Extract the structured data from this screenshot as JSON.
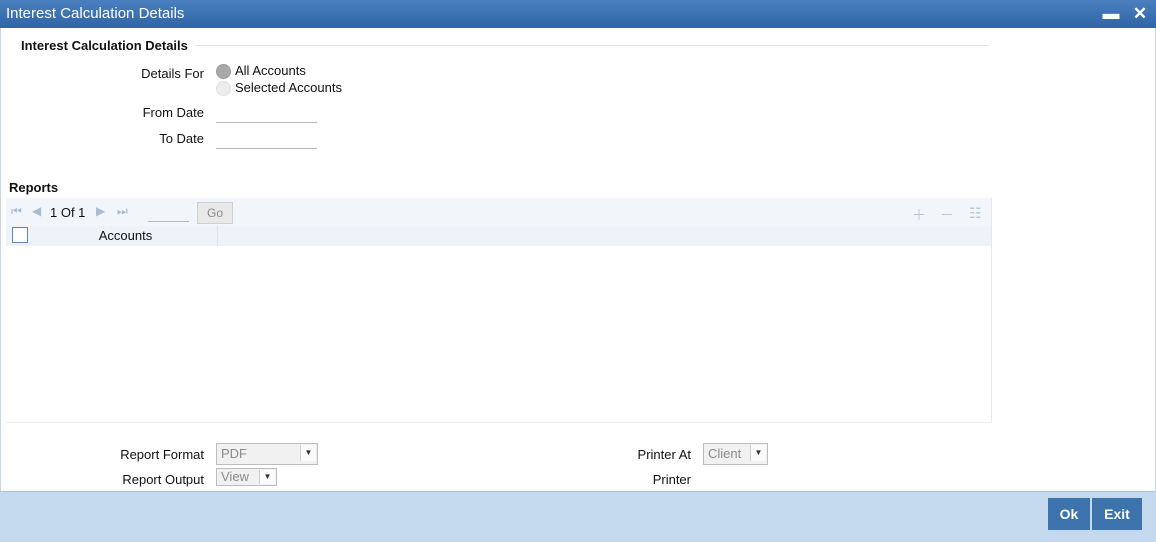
{
  "window": {
    "title": "Interest Calculation Details"
  },
  "form": {
    "section_title": "Interest Calculation Details",
    "details_for_label": "Details For",
    "options": [
      "All Accounts",
      "Selected Accounts"
    ],
    "selected_option": "All Accounts",
    "from_date_label": "From Date",
    "from_date_value": "",
    "to_date_label": "To Date",
    "to_date_value": ""
  },
  "reports": {
    "title": "Reports",
    "pagination": "1 Of 1",
    "go_label": "Go",
    "columns": [
      "Accounts"
    ],
    "rows": []
  },
  "options_panel": {
    "report_format_label": "Report Format",
    "report_format_value": "PDF",
    "report_output_label": "Report Output",
    "report_output_value": "View",
    "printer_at_label": "Printer At",
    "printer_at_value": "Client",
    "printer_label": "Printer"
  },
  "footer": {
    "ok_label": "Ok",
    "exit_label": "Exit"
  },
  "colors": {
    "titlebar": "#2f64a6",
    "footer": "#c4d9ee",
    "button": "#3c73ad"
  }
}
